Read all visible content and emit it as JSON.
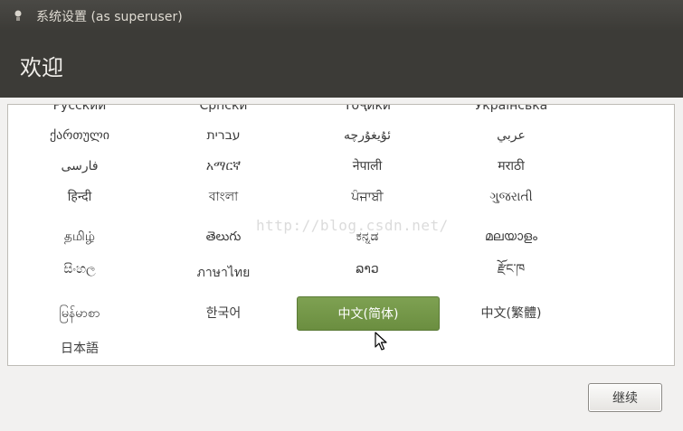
{
  "window": {
    "title": "系统设置 (as superuser)",
    "icon": "app-icon"
  },
  "header": {
    "title": "欢迎"
  },
  "languages": [
    "Русский",
    "Српски",
    "Тоҷикӣ",
    "Українська",
    "ქართული",
    "עברית",
    "ئۇيغۇرچە",
    "عربي",
    "فارسی",
    "አማርኛ",
    "नेपाली",
    "मराठी",
    "हिन्दी",
    "বাংলা",
    "ਪੰਜਾਬੀ",
    "ગુજરાતી",
    "தமிழ்",
    "తెలుగు",
    "ಕನ್ನಡ",
    "മലയാളം",
    "සිංහල",
    "ภาษาไทย",
    "ລາວ",
    "རྫོང་ཁ",
    "မြန်မာစာ",
    "한국어",
    "中文(简体)",
    "中文(繁體)",
    "日本語"
  ],
  "selected_language": "中文(简体)",
  "watermark": "http://blog.csdn.net/",
  "footer": {
    "continue_label": "继续"
  },
  "colors": {
    "header_bg": "#3c3b37",
    "selected_bg": "#769a4a",
    "window_bg": "#f2f1f0"
  }
}
